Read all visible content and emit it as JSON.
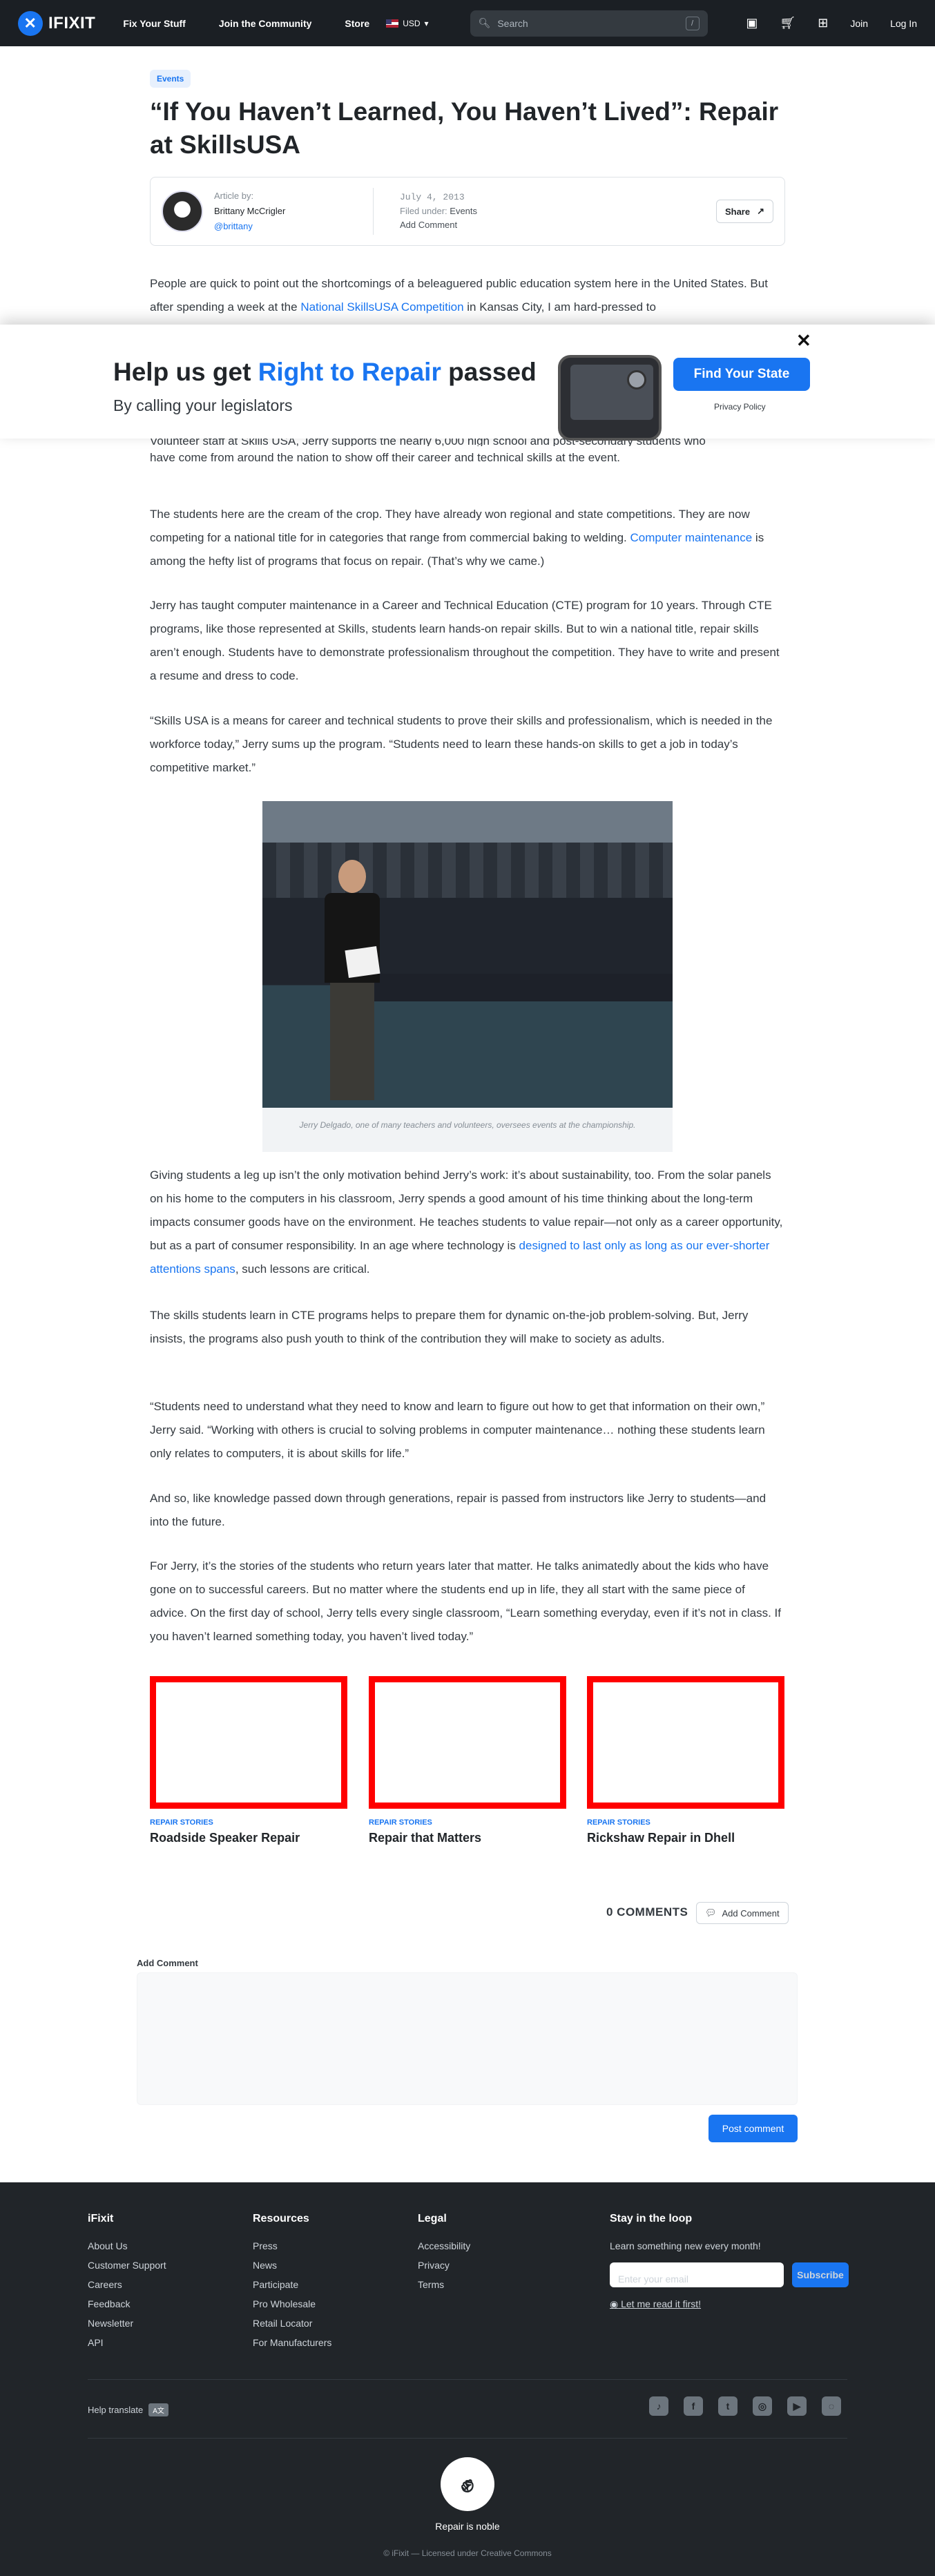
{
  "header": {
    "logo": "IFIXIT",
    "nav": [
      "Fix Your Stuff",
      "Join the Community",
      "Store"
    ],
    "currency": "USD",
    "search_placeholder": "Search",
    "search_hint": "/",
    "join": "Join",
    "login": "Log In"
  },
  "article": {
    "tag": "Events",
    "title": "“If You Haven’t Learned, You Haven’t Lived”: Repair at SkillsUSA",
    "author_label": "Article by:",
    "author_name": "Brittany McCrigler",
    "author_handle": "@brittany",
    "date": "July 4, 2013",
    "filed_label": "Filed under:",
    "filed_value": "Events",
    "add_comment": "Add Comment",
    "share": "Share",
    "p1a": "People are quick to point out the shortcomings of a beleaguered public education system here in the United States. But after spending a week at the ",
    "p1_link": "National SkillsUSA Competition",
    "p1b": " in Kansas City, I am hard-pressed to",
    "p2_tail": "have come from around the nation to show off their career and technical skills at the event.",
    "p3a": "The students here are the cream of the crop. They have already won regional and state competitions. They are now competing for a national title for in categories that range from commercial baking to welding. ",
    "p3_link": "Computer maintenance",
    "p3b": " is among the hefty list of programs that focus on repair. (That’s why we came.)",
    "p4": "Jerry has taught computer maintenance in a Career and Technical Education (CTE) program for 10 years. Through CTE programs, like those represented at Skills, students learn hands-on repair skills. But to win a national title, repair skills aren’t enough. Students have to demonstrate professionalism throughout the competition. They have to write and present a resume and dress to code.",
    "p5": "“Skills USA is a means for career and technical students to prove their skills and professionalism, which is needed in the workforce today,” Jerry sums up the program. “Students need to learn these hands-on skills to get a job in today’s competitive market.”",
    "caption": "Jerry Delgado, one of many teachers and volunteers, oversees events at the championship.",
    "p6a": "Giving students a leg up isn’t the only motivation behind Jerry’s work: it’s about sustainability, too. From the solar panels on his home to the computers in his classroom, Jerry spends a good amount of his time thinking about the long-term impacts consumer goods have on the environment. He teaches students to value repair—not only as a career opportunity, but as a part of consumer responsibility. In an age where technology is ",
    "p6_link": "designed to last only as long as our ever-shorter attentions spans",
    "p6b": ", such lessons are critical.",
    "p7": "The skills students learn in CTE programs helps to prepare them for dynamic on-the-job problem-solving. But, Jerry insists, the programs also push youth to think of the contribution they will make to society as adults.",
    "p8": "“Students need to understand what they need to know and learn to figure out how to get that information on their own,” Jerry said. “Working with others is crucial to solving problems in computer maintenance… nothing these students learn only relates to computers, it is about skills for life.”",
    "p9": "And so, like knowledge passed down through generations, repair is passed from instructors like Jerry to students—and into the future.",
    "p10": "For Jerry, it’s the stories of the students who return years later that matter. He talks animatedly about the kids who have gone on to successful careers. But no matter where the students end up in life, they all start with the same piece of advice. On the first day of school, Jerry tells every single classroom, “Learn something everyday, even if it’s not in class. If you haven’t learned something today, you haven’t lived today.”"
  },
  "banner": {
    "title_a": "Help us get ",
    "title_highlight": "Right to Repair",
    "title_b": " passed",
    "subtitle": "By calling your legislators",
    "button": "Find Your State",
    "privacy": "Privacy Policy",
    "close": "✕",
    "hidden_text": "Volunteer staff at Skills USA, Jerry supports the nearly 6,000 high school and post-secondary students who"
  },
  "related": [
    {
      "kicker": "REPAIR STORIES",
      "title": "Roadside Speaker Repair"
    },
    {
      "kicker": "REPAIR STORIES",
      "title": "Repair that Matters"
    },
    {
      "kicker": "REPAIR STORIES",
      "title": "Rickshaw Repair in Dhell"
    }
  ],
  "comments": {
    "count": "0 COMMENTS",
    "add_button": "Add Comment",
    "label": "Add Comment",
    "post": "Post comment"
  },
  "footer": {
    "cols": [
      {
        "title": "iFixit",
        "items": [
          "About Us",
          "Customer Support",
          "Careers",
          "Feedback",
          "Newsletter",
          "API"
        ]
      },
      {
        "title": "Resources",
        "items": [
          "Press",
          "News",
          "Participate",
          "Pro Wholesale",
          "Retail Locator",
          "For Manufacturers"
        ]
      },
      {
        "title": "Legal",
        "items": [
          "Accessibility",
          "Privacy",
          "Terms"
        ]
      }
    ],
    "newsletter_title": "Stay in the loop",
    "newsletter_sub": "Learn something new every month!",
    "email_placeholder": "Enter your email",
    "subscribe": "Subscribe",
    "read_first": "Let me read it first!",
    "help_translate": "Help translate",
    "slogan": "Repair is noble",
    "copyright": "© iFixit — Licensed under Creative Commons"
  }
}
